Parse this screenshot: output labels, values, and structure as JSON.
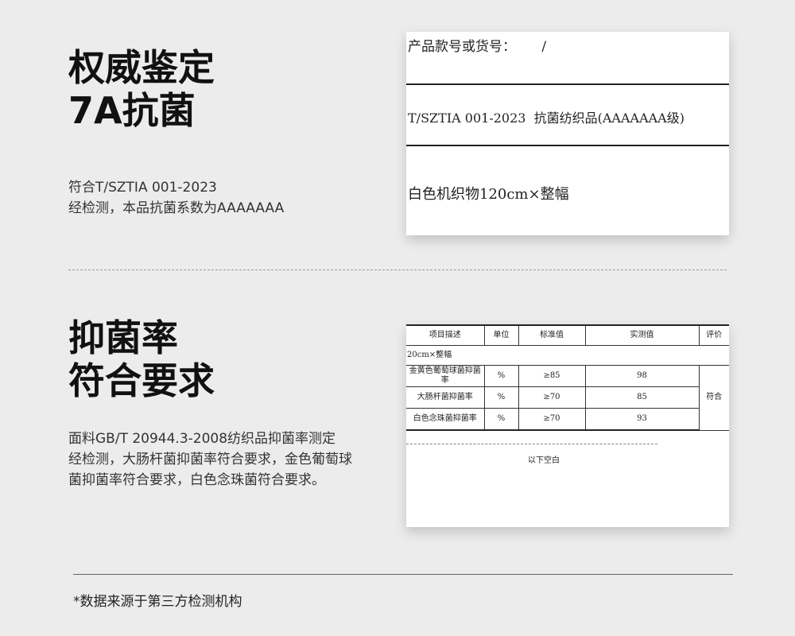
{
  "section1": {
    "title_line1": "权威鉴定",
    "title_line2": "7A抗菌",
    "desc_line1": "符合T/SZTIA 001-2023",
    "desc_line2": "经检测，本品抗菌系数为AAAAAAA"
  },
  "certificate": {
    "row1": "产品款号或货号：      /",
    "row2": "T/SZTIA 001-2023  抗菌纺织品(AAAAAAA级)",
    "row3": "白色机织物120cm×整幅"
  },
  "section2": {
    "title_line1": "抑菌率",
    "title_line2": "符合要求",
    "desc_line1": "面料GB/T 20944.3-2008纺织品抑菌率测定",
    "desc_line2": "经检测，大肠杆菌抑菌率符合要求，金色葡萄球",
    "desc_line3": "菌抑菌率符合要求，白色念珠菌符合要求。"
  },
  "report_table": {
    "headers": [
      "项目描述",
      "单位",
      "标准值",
      "实测值",
      "评价"
    ],
    "spec_row": "20cm×整幅",
    "rows": [
      {
        "item": "金黄色葡萄球菌抑菌率",
        "unit": "%",
        "standard": "≥85",
        "measured": "98"
      },
      {
        "item": "大肠杆菌抑菌率",
        "unit": "%",
        "standard": "≥70",
        "measured": "85"
      },
      {
        "item": "白色念珠菌抑菌率",
        "unit": "%",
        "standard": "≥70",
        "measured": "93"
      }
    ],
    "evaluation": "符合",
    "blank_note": "以下空白"
  },
  "footnote": "*数据来源于第三方检测机构"
}
